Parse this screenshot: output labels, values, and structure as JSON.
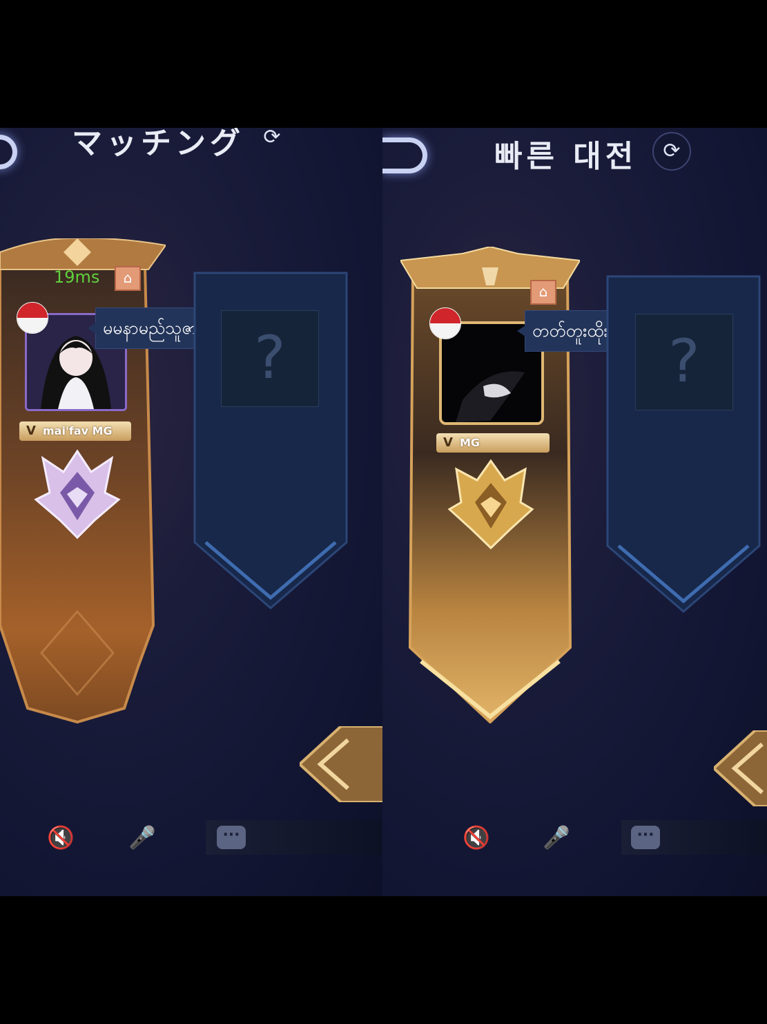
{
  "left_panel": {
    "title": "マッチング",
    "refresh_icon": "⟳",
    "ping": "19ms",
    "player": {
      "chat_message": "မမနာမည်သူဇာမိုး><",
      "name_tag": "mai'fav MG",
      "flag": "indonesia-flag"
    },
    "empty_slot_mark": "?",
    "chat_icon": "···"
  },
  "right_panel": {
    "title": "빠른 대전",
    "refresh_icon": "⟳",
    "player": {
      "chat_message": "တတ်တူးထိုးမယ်><",
      "name_tag": "MG",
      "flag": "indonesia-flag"
    },
    "empty_slot_mark": "?",
    "chat_icon": "···"
  },
  "icons": {
    "speaker": "🔇",
    "mic": "🎤",
    "home": "⌂",
    "rank_badge": "mythic-rank-icon"
  },
  "colors": {
    "gold": "#c89a5a",
    "ping_green": "#5fd13d",
    "panel_bg": "#141836",
    "bubble_bg": "#23345a"
  }
}
